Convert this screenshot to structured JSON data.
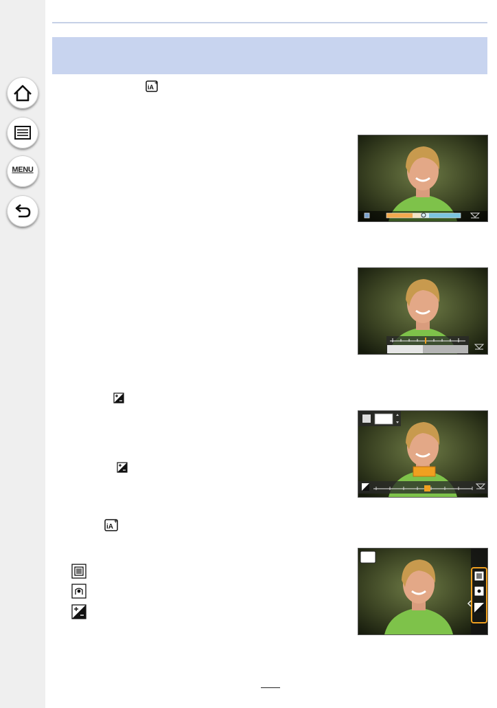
{
  "sidebar": {
    "buttons": [
      {
        "name": "home",
        "icon": "home-icon"
      },
      {
        "name": "contents",
        "icon": "list-icon"
      },
      {
        "name": "menu",
        "icon": "menu-icon",
        "label": "MENU"
      },
      {
        "name": "back",
        "icon": "back-arrow-icon"
      }
    ]
  },
  "colors": {
    "header_band": "#c8d4ef",
    "sidebar": "#efefef",
    "slider_orange": "#f0a020"
  },
  "photos": [
    {
      "name": "color-slider-screen",
      "overlay": "color-adjust-slider"
    },
    {
      "name": "blur-slider-screen",
      "overlay": "blur-adjust-slider"
    },
    {
      "name": "exposure-slider-screen",
      "overlay": "exposure-compensation-slider"
    },
    {
      "name": "control-icons-screen",
      "overlay": "creative-control-icons"
    }
  ]
}
